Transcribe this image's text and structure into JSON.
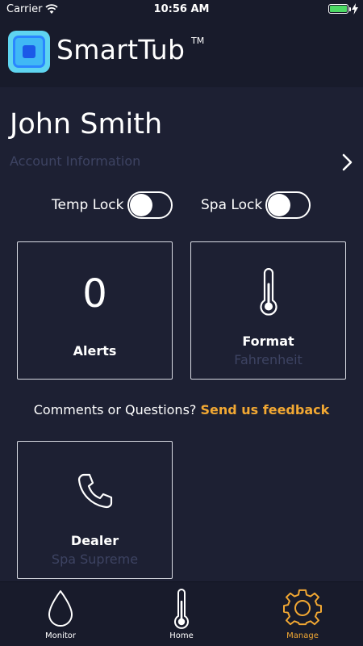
{
  "status_bar": {
    "carrier": "Carrier",
    "time": "10:56 AM"
  },
  "header": {
    "app_name": "SmartTub",
    "trademark": "TM"
  },
  "account": {
    "user_name": "John Smith",
    "link_label": "Account Information",
    "link_icon": "chevron-right-icon"
  },
  "toggles": [
    {
      "label": "Temp Lock",
      "on": false
    },
    {
      "label": "Spa Lock",
      "on": false
    }
  ],
  "cards": {
    "alerts": {
      "count": "0",
      "label": "Alerts"
    },
    "format": {
      "icon": "thermometer-icon",
      "label": "Format",
      "value": "Fahrenheit"
    },
    "dealer": {
      "icon": "phone-icon",
      "label": "Dealer",
      "value": "Spa Supreme"
    }
  },
  "feedback": {
    "prompt": "Comments or Questions?",
    "link_label": "Send us feedback"
  },
  "tab_bar": {
    "active": "Manage",
    "tabs": [
      {
        "label": "Monitor",
        "icon": "water-drop-icon"
      },
      {
        "label": "Home",
        "icon": "thermometer-icon"
      },
      {
        "label": "Manage",
        "icon": "gear-icon"
      }
    ]
  },
  "colors": {
    "background": "#1d2033",
    "bar_background": "#181b2b",
    "accent": "#f2a833",
    "muted_text": "#3d4362",
    "battery": "#4cd964"
  }
}
